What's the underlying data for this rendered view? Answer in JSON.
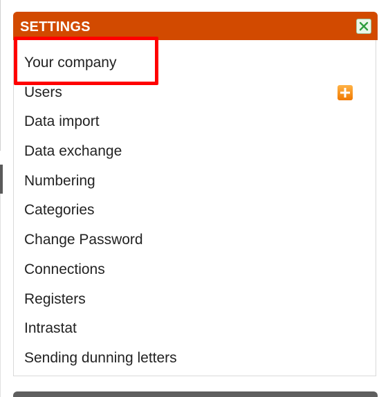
{
  "panel": {
    "title": "SETTINGS",
    "close_icon": "close-icon",
    "items": [
      {
        "label": "Your company"
      },
      {
        "label": "Users",
        "action_icon": "add-icon"
      },
      {
        "label": "Data import"
      },
      {
        "label": "Data exchange"
      },
      {
        "label": "Numbering"
      },
      {
        "label": "Categories"
      },
      {
        "label": "Change Password"
      },
      {
        "label": "Connections"
      },
      {
        "label": "Registers"
      },
      {
        "label": "Intrastat"
      },
      {
        "label": "Sending dunning letters"
      }
    ]
  },
  "colors": {
    "header_bg": "#d24a00",
    "highlight": "#ff0000",
    "add_button": "#f07800",
    "close_button_bg": "#eaf7ea"
  }
}
